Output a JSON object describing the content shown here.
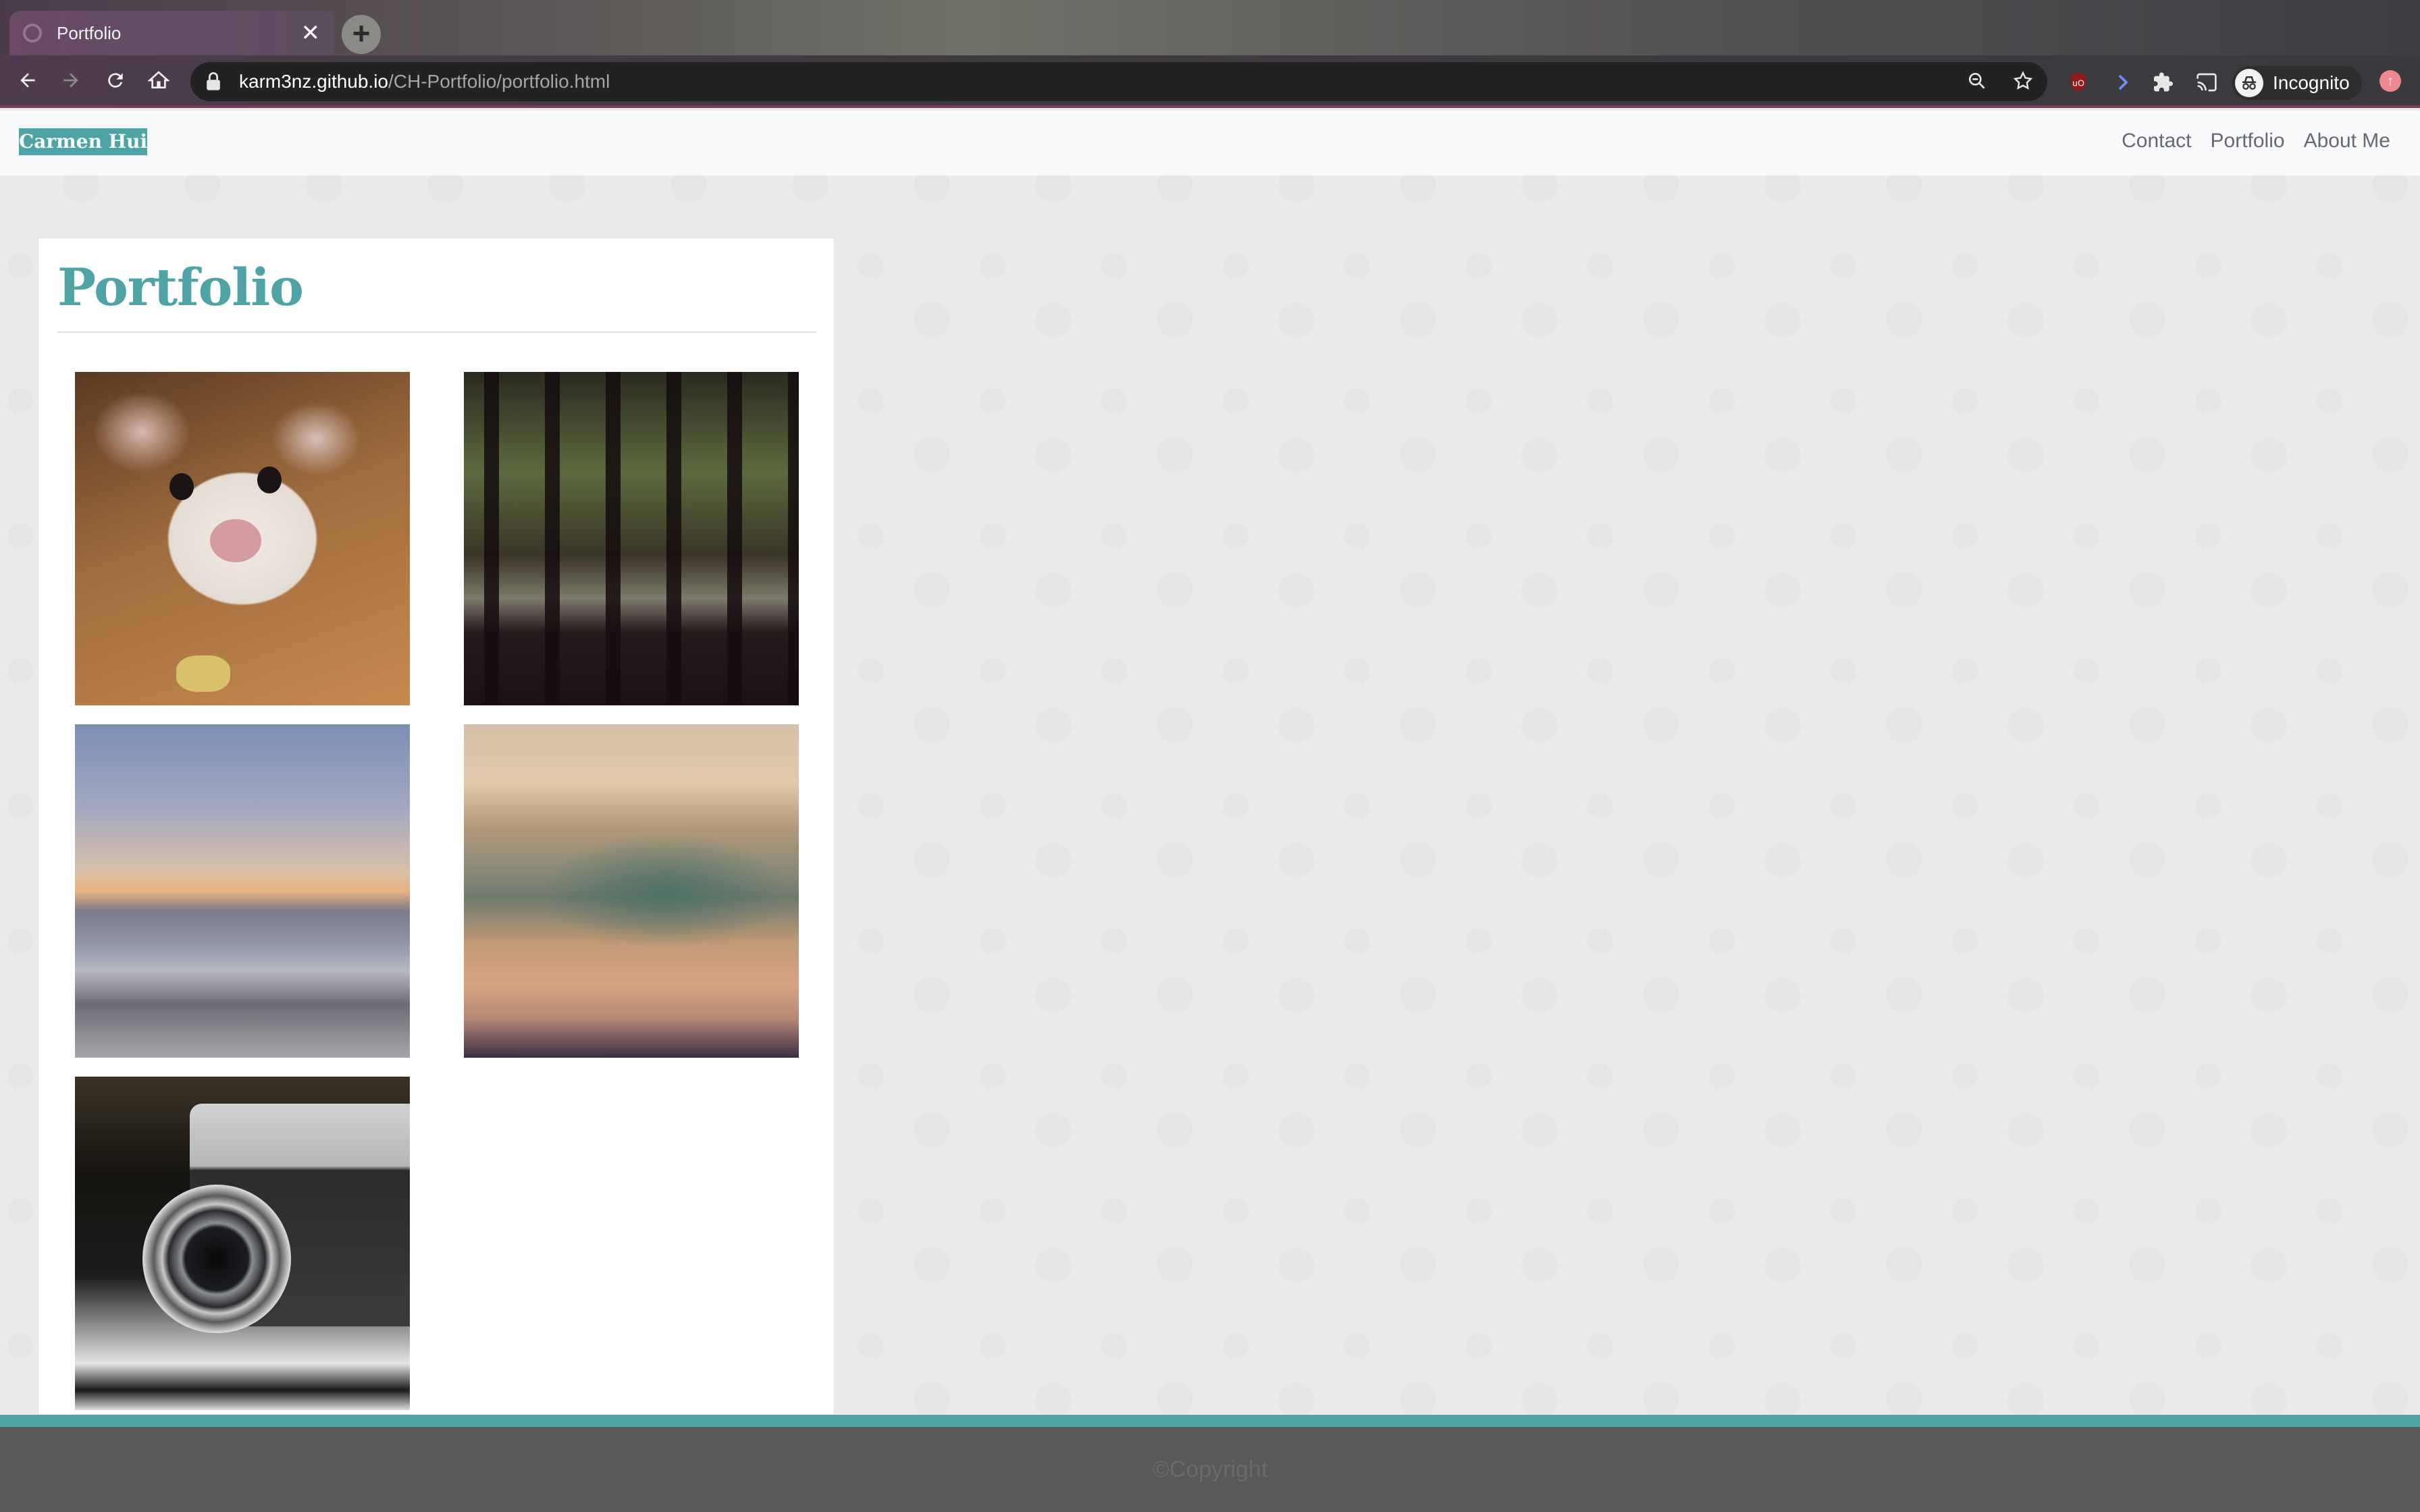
{
  "browser": {
    "tab_title": "Portfolio",
    "url_host": "karm3nz.github.io",
    "url_path": "/CH-Portfolio/portfolio.html",
    "profile_label": "Incognito"
  },
  "site": {
    "brand": "Carmen Hui",
    "nav": [
      "Contact",
      "Portfolio",
      "About Me"
    ],
    "accent_color": "#4fa3a5"
  },
  "main": {
    "title": "Portfolio",
    "photos": [
      {
        "subject": "hamster"
      },
      {
        "subject": "forest"
      },
      {
        "subject": "sunset-sea"
      },
      {
        "subject": "ocean-wave"
      },
      {
        "subject": "vintage-camera"
      }
    ]
  },
  "footer": {
    "copyright": "©Copyright"
  }
}
